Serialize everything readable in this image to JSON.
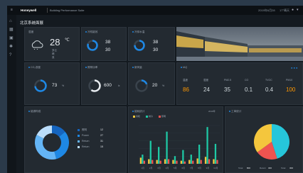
{
  "topbar": {
    "brand": "Honeywell",
    "app_title": "Building Performance Suite",
    "datetime": "2019年6月28",
    "weather": "17°晴天"
  },
  "page_title": "北京系统面展",
  "weather_card": {
    "title": "湿度",
    "temp": "28",
    "unit": "℃",
    "line1": "多云",
    "line2": "晴",
    "line3": "良"
  },
  "chiller_card": {
    "title": "冷机能效",
    "v1": "38",
    "v2": "30",
    "ring": 0.8
  },
  "water_card": {
    "title": "冷却水温",
    "v1": "38",
    "v2": "30",
    "ring": 0.75
  },
  "co2_card": {
    "title": "CO₂浓度",
    "value": "73",
    "unit": "%",
    "ring": 0.73
  },
  "light_card": {
    "title": "照明功率",
    "value": "600",
    "unit": "lx",
    "ring": 0.6
  },
  "air_card": {
    "title": "新风量",
    "value": "20",
    "unit": "%",
    "ring": 0.2
  },
  "metrics_card": {
    "title": "IAQ",
    "items": [
      {
        "label": "温度",
        "value": "86",
        "color": "#ff9800"
      },
      {
        "label": "湿度",
        "value": "24",
        "color": "#cfd8dc"
      },
      {
        "label": "PM2.5",
        "value": "35",
        "color": "#cfd8dc"
      },
      {
        "label": "CO",
        "value": "0.1",
        "color": "#cfd8dc"
      },
      {
        "label": "TVOC",
        "value": "0.4",
        "color": "#cfd8dc"
      },
      {
        "label": "PM10",
        "value": "100",
        "color": "#ff9800"
      }
    ]
  },
  "donut_card": {
    "title": "能源构成",
    "rows": [
      {
        "label": "照明",
        "value": "12"
      },
      {
        "label": "Power",
        "value": "27"
      },
      {
        "label": "Return",
        "value": "31"
      },
      {
        "label": "Return",
        "value": "15"
      }
    ]
  },
  "bar_card": {
    "title": "能耗统计",
    "legend": [
      "供暖",
      "制冷",
      "照明"
    ],
    "subtitle": "2019年"
  },
  "pie_card": {
    "title": "工单统计",
    "labels": [
      {
        "label": "Total",
        "value": "800"
      },
      {
        "label": "Return",
        "value": "300"
      },
      {
        "label": "Total",
        "value": "300"
      }
    ]
  },
  "chart_data": [
    {
      "type": "bar",
      "title": "能耗统计",
      "categories": [
        "1月",
        "2月",
        "3月",
        "4月",
        "5月",
        "6月",
        "7月",
        "8月",
        "9月",
        "10月"
      ],
      "series": [
        {
          "name": "供暖",
          "values": [
            8,
            6,
            5,
            6,
            5,
            4,
            5,
            7,
            9,
            6
          ]
        },
        {
          "name": "制冷",
          "values": [
            12,
            30,
            22,
            42,
            10,
            18,
            12,
            25,
            48,
            26
          ]
        },
        {
          "name": "照明",
          "values": [
            4,
            5,
            4,
            6,
            4,
            3,
            4,
            5,
            6,
            5
          ]
        }
      ],
      "ylim": [
        0,
        50
      ],
      "colors": [
        "#f4c63d",
        "#1ec8a5",
        "#ef5350"
      ]
    },
    {
      "type": "pie",
      "title": "工单统计",
      "slices": [
        {
          "value": 45,
          "color": "#26c6da"
        },
        {
          "value": 20,
          "color": "#ef5350"
        },
        {
          "value": 35,
          "color": "#f4c63d"
        }
      ]
    },
    {
      "type": "pie",
      "title": "能源构成",
      "slices": [
        {
          "value": 12,
          "color": "#1565c0"
        },
        {
          "value": 27,
          "color": "#1e88e5"
        },
        {
          "value": 31,
          "color": "#64b5f6"
        },
        {
          "value": 15,
          "color": "#bbdefb"
        }
      ]
    }
  ]
}
